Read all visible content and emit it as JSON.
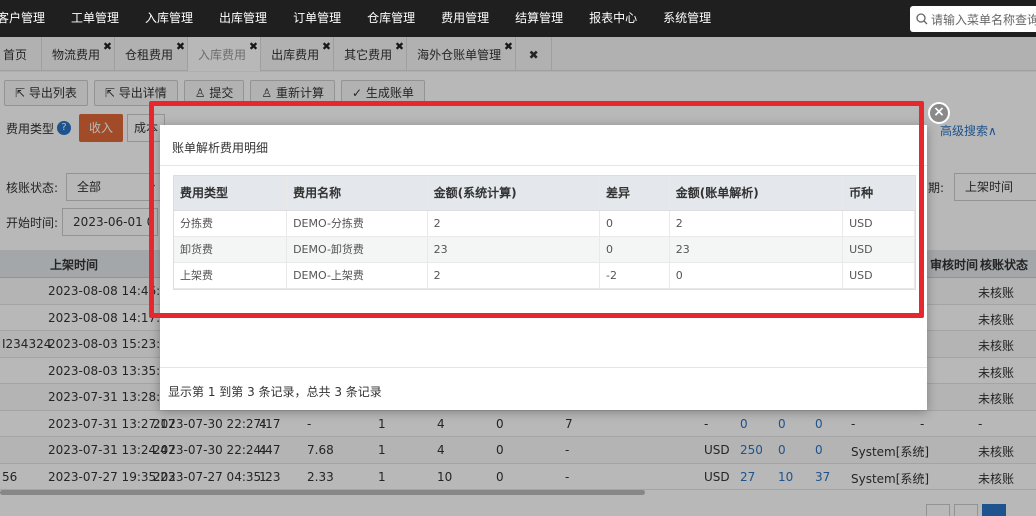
{
  "nav": {
    "items": [
      "客户管理",
      "工单管理",
      "入库管理",
      "出库管理",
      "订单管理",
      "仓库管理",
      "费用管理",
      "结算管理",
      "报表中心",
      "系统管理"
    ],
    "search_placeholder": "请输入菜单名称查询"
  },
  "tabs": [
    {
      "label": "首页",
      "closable": false
    },
    {
      "label": "物流费用",
      "closable": true
    },
    {
      "label": "仓租费用",
      "closable": true
    },
    {
      "label": "入库费用",
      "closable": true,
      "active": true
    },
    {
      "label": "出库费用",
      "closable": true
    },
    {
      "label": "其它费用",
      "closable": true
    },
    {
      "label": "海外仓账单管理",
      "closable": true
    }
  ],
  "toolbar": {
    "export_list": "导出列表",
    "export_detail": "导出详情",
    "submit": "提交",
    "recalc": "重新计算",
    "gen_bill": "生成账单"
  },
  "filters": {
    "fee_type_label": "费用类型",
    "income": "收入",
    "cost": "成本",
    "status_label": "核账状态:",
    "status_value": "全部",
    "start_label": "开始时间:",
    "start_value": "2023-06-01 0",
    "date_type_label": "期:",
    "date_type_value": "上架时间",
    "advanced": "高级搜索"
  },
  "bg_table": {
    "headers": {
      "shelf_time": "上架时间",
      "audit_time": "审核时间",
      "status": "核账状态"
    },
    "rows": [
      {
        "prefix": "",
        "shelf": "2023-08-08 14:46:01",
        "status": "未核账"
      },
      {
        "prefix": "",
        "shelf": "2023-08-08 14:17:23",
        "status": "未核账"
      },
      {
        "prefix": "I234324",
        "shelf": "2023-08-03 15:23:51",
        "status": "未核账"
      },
      {
        "prefix": "",
        "shelf": "2023-08-03 13:35:34",
        "status": "未核账"
      },
      {
        "prefix": "",
        "shelf": "2023-07-31 13:28:53",
        "status": "未核账"
      },
      {
        "prefix": "",
        "shelf": "2023-07-31 13:27:17",
        "c2": "2023-07-30 22:27:17",
        "c3": "4",
        "c4": "-",
        "c5": "1",
        "c6": "4",
        "c7": "0",
        "c8": "7",
        "c9": "-",
        "c10": "0",
        "c11": "0",
        "c12": "0",
        "c13": "-",
        "c14": "-",
        "status": "-"
      },
      {
        "prefix": "",
        "shelf": "2023-07-31 13:24:47",
        "c2": "2023-07-30 22:24:47",
        "c3": "4",
        "c4": "7.68",
        "c5": "1",
        "c6": "4",
        "c7": "0",
        "c8": "-",
        "c9": "USD",
        "c10": "250",
        "c11": "0",
        "c12": "0",
        "c13": "System[系统]",
        "c14": "-",
        "status": "未核账"
      },
      {
        "prefix": "56",
        "shelf": "2023-07-27 19:35:23",
        "c2": "2023-07-27 04:35:23",
        "c3": "1",
        "c4": "2.33",
        "c5": "1",
        "c6": "10",
        "c7": "0",
        "c8": "-",
        "c9": "USD",
        "c10": "27",
        "c11": "10",
        "c12": "37",
        "c13": "System[系统]",
        "c14": "-",
        "status": "未核账"
      }
    ]
  },
  "modal": {
    "title": "账单解析费用明细",
    "headers": [
      "费用类型",
      "费用名称",
      "金额(系统计算)",
      "差异",
      "金额(账单解析)",
      "币种"
    ],
    "rows": [
      [
        "分拣费",
        "DEMO-分拣费",
        "2",
        "0",
        "2",
        "USD"
      ],
      [
        "卸货费",
        "DEMO-卸货费",
        "23",
        "0",
        "23",
        "USD"
      ],
      [
        "上架费",
        "DEMO-上架费",
        "2",
        "-2",
        "0",
        "USD"
      ]
    ],
    "footer": "显示第 1 到第 3 条记录，总共 3 条记录"
  },
  "colors": {
    "nav_bg": "#1f1f1f",
    "accent": "#e0683a",
    "highlight": "#e8262e",
    "link": "#2a74c4"
  }
}
